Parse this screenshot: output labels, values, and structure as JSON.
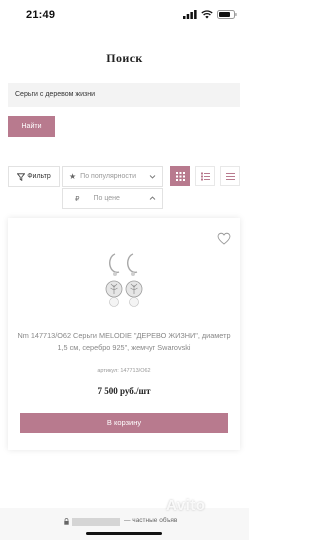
{
  "status": {
    "time": "21:49"
  },
  "page": {
    "title": "Поиск"
  },
  "search": {
    "value": "Серьги с деревом жизни",
    "button_label": "Найти"
  },
  "toolbar": {
    "filter_label": "Фильтр",
    "sort_label": "По популярности",
    "price_currency": "₽",
    "price_label": "По цене"
  },
  "product": {
    "name": "Nm 147713/О62 Серьги MELODIE \"ДЕРЕВО ЖИЗНИ\", диаметр 1,5 см, серебро 925\", жемчуг Swarovski",
    "sku": "артикул: 147713/О62",
    "price": "7 500 руб./шт",
    "cart_button": "В корзину"
  },
  "browser": {
    "url_text": "— частные объяв"
  },
  "watermark": "Avito",
  "colors": {
    "accent": "#b87a8e",
    "input_bg": "#f3f3f3"
  },
  "icons": [
    "signal-icon",
    "wifi-icon",
    "battery-icon",
    "funnel-icon",
    "star-icon",
    "chevron-down-icon",
    "chevron-up-icon",
    "grid-view-icon",
    "list-view-icon",
    "rows-view-icon",
    "heart-icon",
    "lock-icon"
  ]
}
